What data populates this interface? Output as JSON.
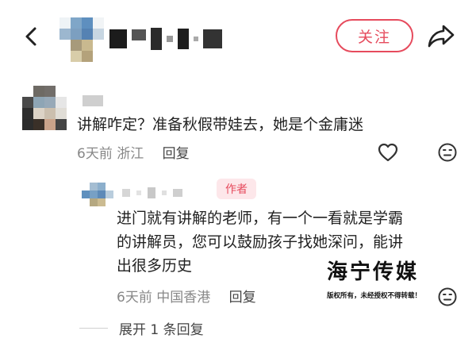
{
  "header": {
    "follow_label": "关注"
  },
  "comment1": {
    "text": "讲解咋定？准备秋假带娃去，她是个金庸迷",
    "time": "6天前",
    "location": "浙江",
    "reply_label": "回复"
  },
  "comment2": {
    "author_tag": "作者",
    "line1": "进门就有讲解的老师，有一个一看就是学霸",
    "line2": "的讲解员，您可以鼓励孩子找她深问，能讲",
    "line3": "出很多历史",
    "time": "6天前",
    "location": "中国香港",
    "reply_label": "回复"
  },
  "expand_label": "展开 1 条回复",
  "watermark": {
    "title": "海宁传媒",
    "subtitle": "版权所有，未经授权不得转载！"
  },
  "colors": {
    "accent": "#e64b5d",
    "author_tag_bg": "#fde7ea",
    "meta_gray": "#888888"
  }
}
